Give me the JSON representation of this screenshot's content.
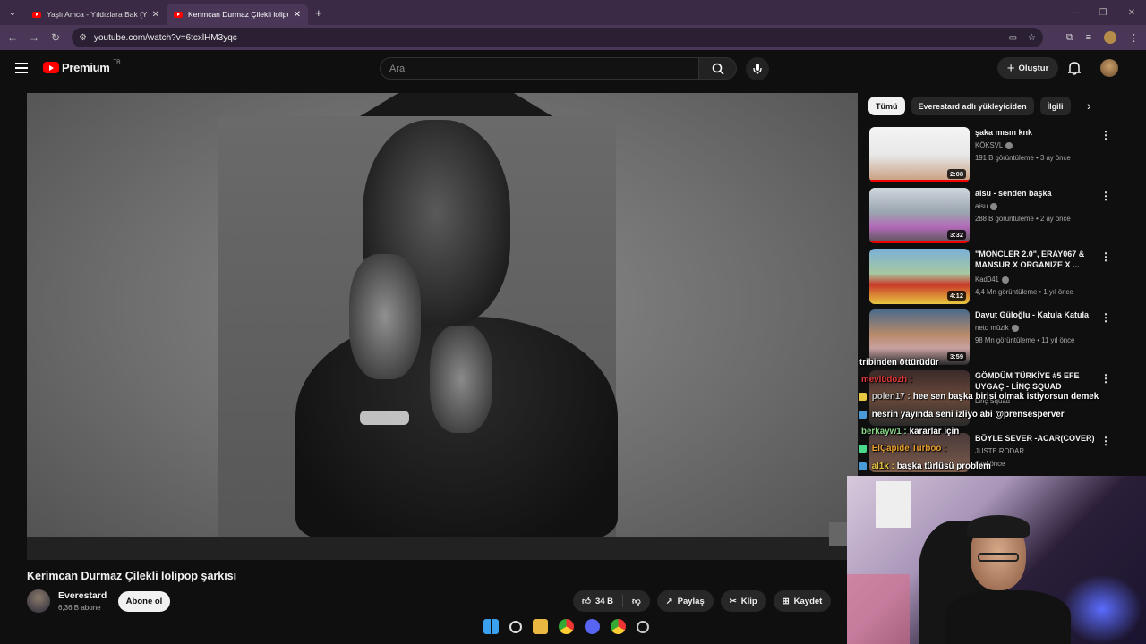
{
  "browser": {
    "tabs": [
      {
        "title": "Yaşlı Amca - Yıldızlara Bak (Yaşl"
      },
      {
        "title": "Kerimcan Durmaz Çilekli lolipop"
      }
    ],
    "url": "youtube.com/watch?v=6tcxlHM3yqc"
  },
  "masthead": {
    "logo": "Premium",
    "country": "TR",
    "search_placeholder": "Ara",
    "create_label": "Oluştur"
  },
  "video": {
    "title": "Kerimcan Durmaz Çilekli lolipop şarkısı",
    "channel": "Everestard",
    "subscribers": "6,36 B abone",
    "subscribe_label": "Abone ol",
    "likes": "34 B",
    "share_label": "Paylaş",
    "clip_label": "Klip",
    "save_label": "Kaydet"
  },
  "chips": [
    "Tümü",
    "Everestard adlı yükleyiciden",
    "İlgili"
  ],
  "recommendations": [
    {
      "title": "şaka mısın knk",
      "channel": "KÖKSVL",
      "meta": "191 B görüntüleme • 3 ay önce",
      "duration": "2:08"
    },
    {
      "title": "aisu - senden başka",
      "channel": "aisu",
      "meta": "288 B görüntüleme • 2 ay önce",
      "duration": "3:32"
    },
    {
      "title": "\"MONCLER 2.0\", ERAY067 & MANSUR X ORGANIZE X ...",
      "channel": "Kad041",
      "meta": "4,4 Mn görüntüleme • 1 yıl önce",
      "duration": "4:12"
    },
    {
      "title": "Davut Güloğlu - Katula Katula",
      "channel": "netd müzik",
      "meta": "98 Mn görüntüleme • 11 yıl önce",
      "duration": "3:59"
    },
    {
      "title": "GÖMDÜM TÜRKİYE #5 EFE UYGAÇ - LİNÇ SQUAD",
      "channel": "Linç Squad",
      "meta": "",
      "duration": ""
    },
    {
      "title": "BÖYLE SEVER -ACAR(COVER)",
      "channel": "JUSTE RODAR",
      "meta": "6 yıl önce",
      "duration": ""
    }
  ],
  "chat": [
    {
      "user": "",
      "text": "tribinden öttürüdür"
    },
    {
      "user": "mevlüdozh :",
      "text": ""
    },
    {
      "user": "polen17 :",
      "text": "hee sen başka birisi olmak istiyorsun demek"
    },
    {
      "user": "",
      "text": "nesrin yayında seni izliyo abi @prensesperver"
    },
    {
      "user": "berkayw1 :",
      "text": "kararlar için"
    },
    {
      "user": "ElÇapide Turboo :",
      "text": ""
    },
    {
      "user": "al1k :",
      "text": "başka türlüsü problem"
    }
  ],
  "colors": {
    "accent": "#ff0000",
    "bg": "#0f0f0f",
    "tab_active": "#4a3758"
  }
}
